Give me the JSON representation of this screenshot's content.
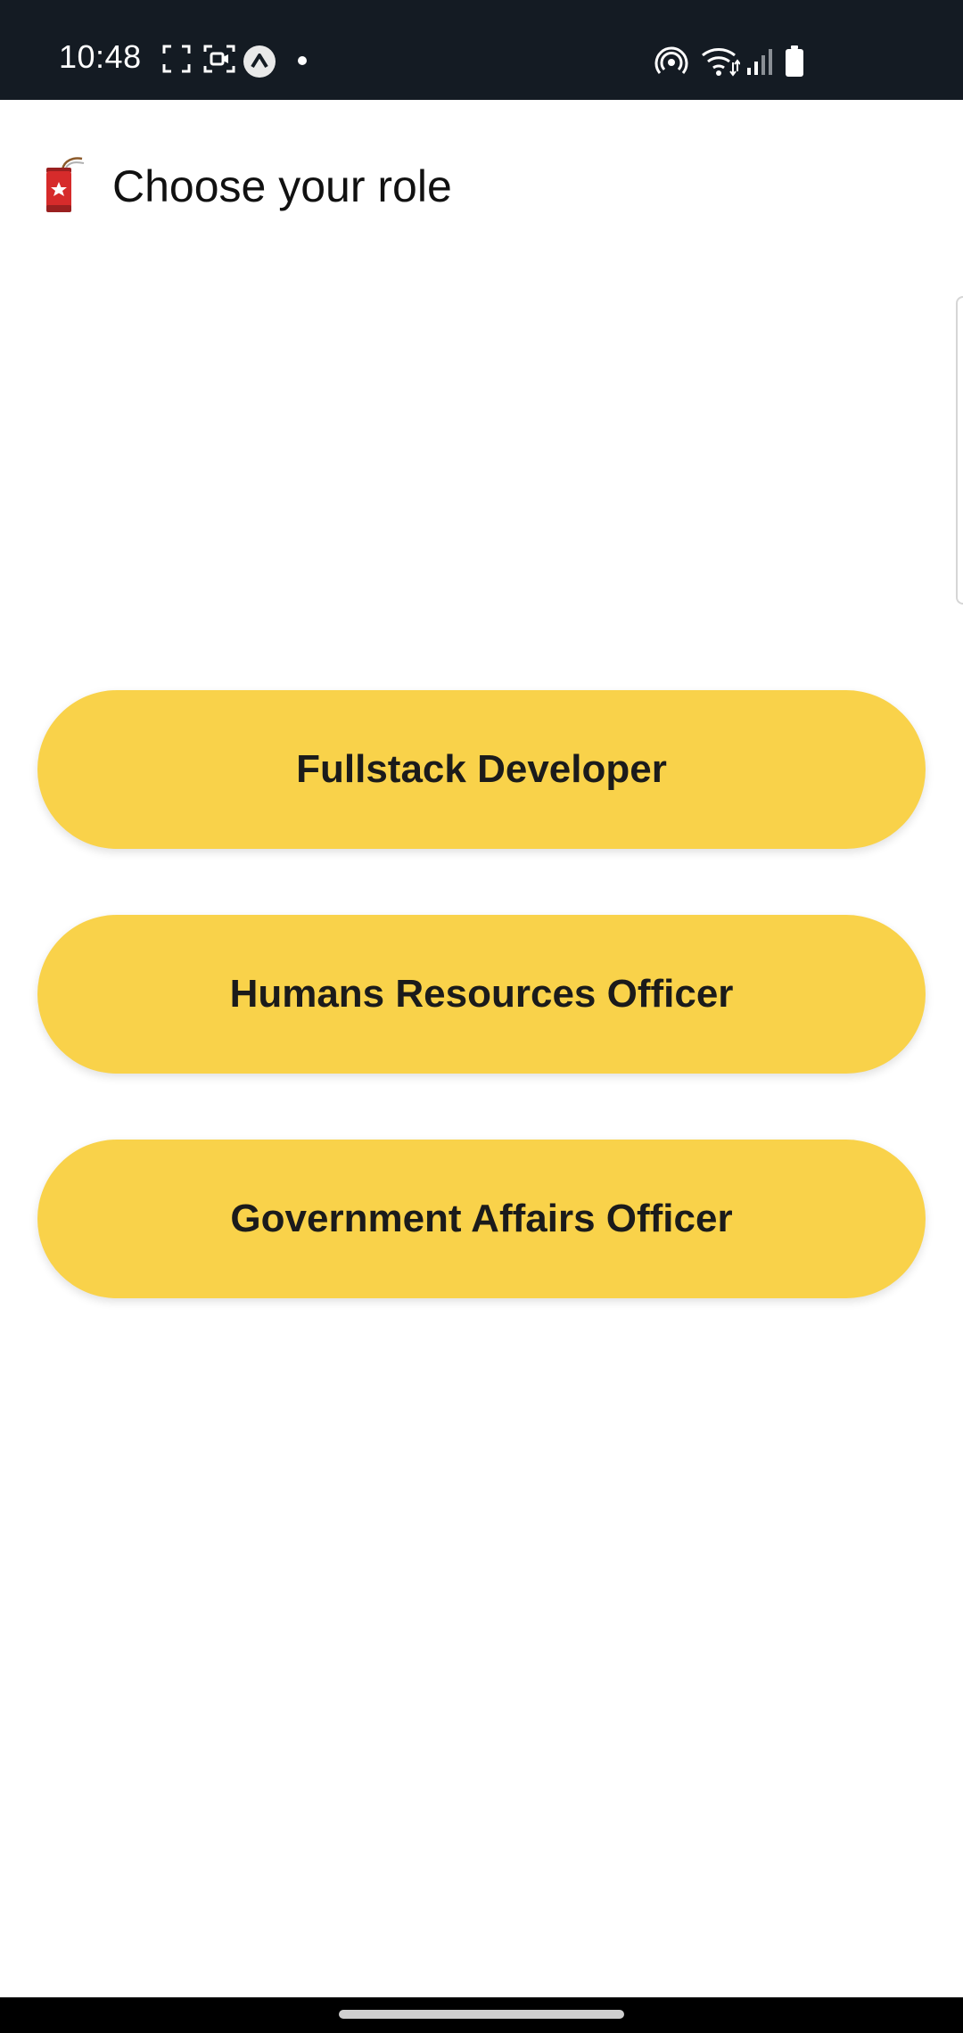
{
  "status_bar": {
    "time": "10:48",
    "left_icons": [
      "screenshot-frame-icon",
      "screen-record-icon",
      "app-notification-icon",
      "notification-dot-icon"
    ],
    "right_icons": [
      "hotspot-icon",
      "wifi-icon",
      "cell-signal-icon",
      "battery-icon"
    ]
  },
  "header": {
    "icon": "firecracker-icon",
    "title": "Choose your role"
  },
  "roles": [
    {
      "label": "Fullstack Developer"
    },
    {
      "label": "Humans Resources Officer"
    },
    {
      "label": "Government Affairs Officer"
    }
  ],
  "colors": {
    "status_bar_bg": "#141b23",
    "button_bg": "#f9d24a",
    "background": "#ffffff"
  }
}
